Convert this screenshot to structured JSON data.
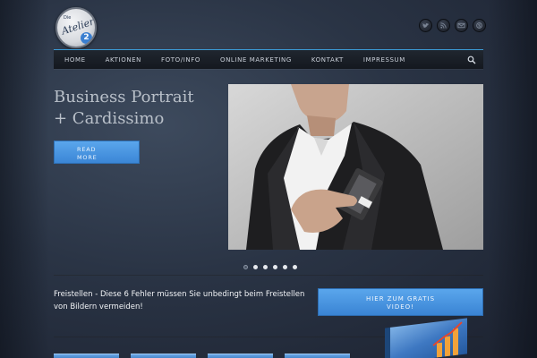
{
  "logo": {
    "top_text": "Die",
    "script_text": "Atelier",
    "number": "2"
  },
  "social": [
    {
      "icon": "twitter-icon"
    },
    {
      "icon": "rss-icon"
    },
    {
      "icon": "mail-icon"
    },
    {
      "icon": "skype-icon"
    }
  ],
  "nav": {
    "items": [
      "HOME",
      "AKTIONEN",
      "FOTO/INFO",
      "ONLINE MARKETING",
      "KONTAKT",
      "IMPRESSUM"
    ],
    "search_icon": "search-icon",
    "accent_color": "#3b9bd6"
  },
  "hero": {
    "title_line1": "Business Portrait",
    "title_line2": "+ Cardissimo",
    "read_more_line1": "READ",
    "read_more_line2": "MORE",
    "slides_total": 6,
    "active_slide": 1
  },
  "teaser": {
    "text": "Freistellen - Diese 6 Fehler müssen Sie unbedingt beim Freistellen von Bildern vermeiden!",
    "cta_line1": "HIER ZUM GRATIS",
    "cta_line2": "VIDEO!"
  },
  "colors": {
    "button_blue": "#4a96e2",
    "background": "#2a3445"
  }
}
